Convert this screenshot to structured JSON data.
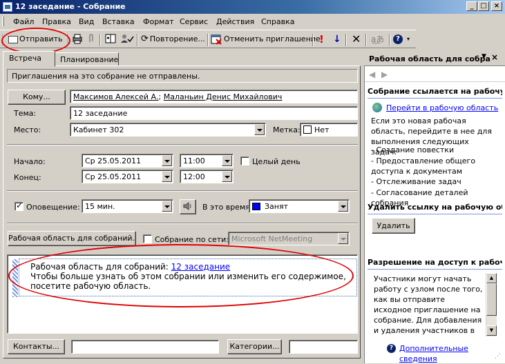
{
  "window": {
    "title": "12 заседание - Собрание"
  },
  "menu": [
    "Файл",
    "Правка",
    "Вид",
    "Вставка",
    "Формат",
    "Сервис",
    "Действия",
    "Справка"
  ],
  "toolbar": {
    "send": "Отправить",
    "recurrence": "Повторение...",
    "cancel_invitation": "Отменить приглашение"
  },
  "tabs": [
    "Встреча",
    "Планирование"
  ],
  "info_message": "Приглашения на это собрание не отправлены.",
  "form": {
    "to_button": "Кому...",
    "attendees": [
      "Максимов Алексей А.",
      "Маланьин Денис Михайлович"
    ],
    "subject_label": "Тема:",
    "subject_value": "12 заседание",
    "location_label": "Место:",
    "location_value": "Кабинет 302",
    "label_label": "Метка:",
    "label_value": "Нет",
    "start_label": "Начало:",
    "start_date": "Ср 25.05.2011",
    "start_time": "11:00",
    "allday_label": "Целый день",
    "end_label": "Конец:",
    "end_date": "Ср 25.05.2011",
    "end_time": "12:00",
    "reminder_label": "Оповещение:",
    "reminder_value": "15 мин.",
    "showas_label": "В это время:",
    "showas_value": "Занят",
    "showas_color": "#0000ff",
    "workspace_button": "Рабочая область для собраний...",
    "online_label": "Собрание по сети:",
    "online_value": "Microsoft NetMeeting",
    "contacts_button": "Контакты...",
    "categories_button": "Категории..."
  },
  "notes": {
    "prefix": "Рабочая область для собраний: ",
    "link": "12 заседание",
    "text": "Чтобы больше узнать об этом собрании или изменить его содержимое, посетите рабочую область."
  },
  "pane": {
    "title": "Рабочая область для собра",
    "section1_title": "Собрание ссылается на рабочую",
    "goto_link": "Перейти в рабочую область",
    "intro": "Если это новая рабочая область, перейдите в нее для выполнения следующих задач:",
    "tasks": [
      "- Создание повестки",
      "- Предоставление общего доступа к документам",
      "- Отслеживание задач",
      "- Согласование деталей собрания"
    ],
    "section2_title": "Удалить ссылку на рабочую обл",
    "remove_button": "Удалить",
    "section3_title": "Разрешение на доступ к рабочей",
    "permission_text": "Участники могут начать работу с узлом после того, как вы отправите исходное приглашение на собрание. Для добавления и удаления участников в дальнейшем потребуется обновить",
    "more_link": "Дополнительные сведения"
  },
  "colors": {
    "title_start": "#0a246a",
    "title_end": "#a6caf0",
    "link": "#0000ff",
    "annotation": "#e00000"
  }
}
